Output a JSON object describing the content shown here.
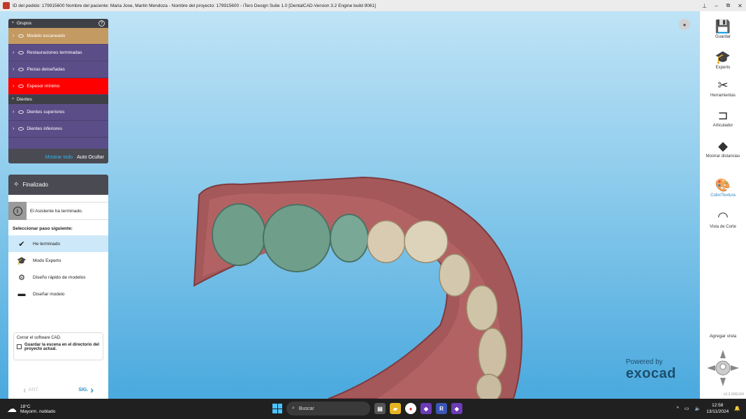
{
  "titlebar": {
    "title": "ID del pedido: 179915600 Nombre del paciente: Maria Jose, Martin Mendoza - Nombre del proyecto: 179915600 - iTero Design Suite 1.0 [DentalCAD-Version 3.2 Engine build 9061]",
    "minimize": "–",
    "restore": "⧉",
    "close": "✕",
    "pin": "⊥"
  },
  "groups": {
    "header": "Grupos",
    "items": [
      {
        "label": "Modelo escaneado"
      },
      {
        "label": "Restauraciones terminadas"
      },
      {
        "label": "Piezas deiseñadas"
      },
      {
        "label": "Espesor mínimo"
      }
    ],
    "teeth_header": "Dientes",
    "teeth_items": [
      {
        "label": "Dientes superiores"
      },
      {
        "label": "Dientes inferiores"
      }
    ],
    "show_all": "Mostrar todo",
    "auto_hide": "Auto Ocultar",
    "help": "?"
  },
  "wizard": {
    "title": "Finalizado",
    "info_message": "El Asistente ha terminado.",
    "select_next": "Seleccionar paso siguiente:",
    "options": [
      {
        "label": "He terminado",
        "icon": "checkmark-icon"
      },
      {
        "label": "Modo Experto",
        "icon": "graduation-cap-icon"
      },
      {
        "label": "Diseño rápido de modelos",
        "icon": "quick-model-icon"
      },
      {
        "label": "Diseñar modelo",
        "icon": "model-design-icon"
      }
    ],
    "close_cad": "Cerrar el software CAD.",
    "save_scene": "Guardar la escena en el directorio del proyecto actual.",
    "prev": "ANT.",
    "next": "SIG."
  },
  "powered": {
    "line1": "Powered by",
    "line2": "exocad"
  },
  "toolbar": {
    "items": [
      {
        "label": "Guardar",
        "icon": "save-icon"
      },
      {
        "label": "Experto",
        "icon": "graduation-cap-icon"
      },
      {
        "label": "Herramientas",
        "icon": "tools-icon"
      },
      {
        "label": "Articulador",
        "icon": "articulator-icon"
      },
      {
        "label": "Mostrar distancias",
        "icon": "distances-icon"
      },
      {
        "label": "Color/Textura",
        "icon": "palette-icon"
      },
      {
        "label": "Vista de Corte",
        "icon": "cut-view-icon"
      }
    ],
    "add_view": "Agregar vista",
    "version": "v3.2-9061/64"
  },
  "taskbar": {
    "temp": "18°C",
    "weather": "Mayorm. nublado",
    "search_placeholder": "Buscar",
    "time": "12:58",
    "date": "13/11/2024"
  },
  "colors": {
    "accent": "#2a8fc9",
    "group_active": "#c49a63",
    "group_red": "#ff0000",
    "group_bg": "#5b4e88"
  }
}
